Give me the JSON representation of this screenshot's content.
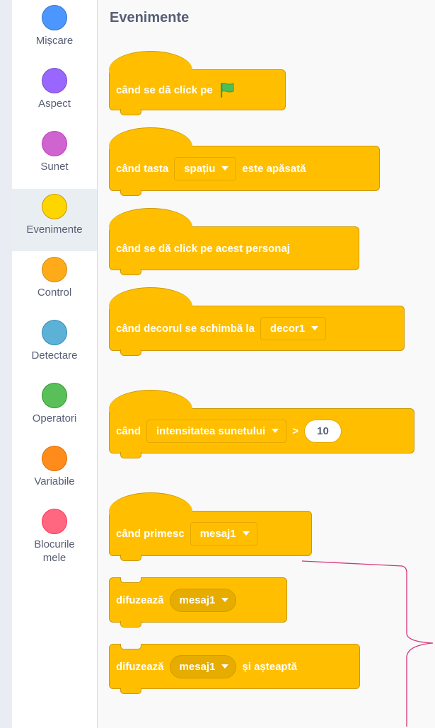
{
  "categories": [
    {
      "id": "motion",
      "label": "Mișcare",
      "color": "#4c97ff",
      "border": "#3373cc",
      "selected": false
    },
    {
      "id": "looks",
      "label": "Aspect",
      "color": "#9966ff",
      "border": "#774dcb",
      "selected": false
    },
    {
      "id": "sound",
      "label": "Sunet",
      "color": "#cf63cf",
      "border": "#bd42bd",
      "selected": false
    },
    {
      "id": "events",
      "label": "Evenimente",
      "color": "#ffd500",
      "border": "#cc9900",
      "selected": true
    },
    {
      "id": "control",
      "label": "Control",
      "color": "#ffab19",
      "border": "#cf8b17",
      "selected": false
    },
    {
      "id": "sensing",
      "label": "Detectare",
      "color": "#5cb1d6",
      "border": "#2e8eb8",
      "selected": false
    },
    {
      "id": "operators",
      "label": "Operatori",
      "color": "#59c059",
      "border": "#389438",
      "selected": false
    },
    {
      "id": "variables",
      "label": "Variabile",
      "color": "#ff8c1a",
      "border": "#db6e00",
      "selected": false
    },
    {
      "id": "myblocks",
      "label": "Blocurile mele",
      "color": "#ff6680",
      "border": "#ff3355",
      "selected": false
    }
  ],
  "palette": {
    "title": "Evenimente",
    "blocks": {
      "flag_clicked": {
        "text": "când se dă click pe",
        "icon": "green-flag-icon"
      },
      "key_pressed": {
        "pre": "când tasta",
        "key": "spațiu",
        "post": "este apăsată"
      },
      "sprite_clicked": {
        "text": "când se dă click pe acest personaj"
      },
      "backdrop_switches": {
        "pre": "când decorul se schimbă la",
        "backdrop": "decor1"
      },
      "greater_than": {
        "pre": "când",
        "sensor": "intensitatea sunetului",
        "op": ">",
        "value": "10"
      },
      "receive": {
        "pre": "când primesc",
        "message": "mesaj1"
      },
      "broadcast": {
        "pre": "difuzează",
        "message": "mesaj1"
      },
      "broadcast_wait": {
        "pre": "difuzează",
        "message": "mesaj1",
        "post": "și așteaptă"
      }
    }
  },
  "colors": {
    "events_block": "#ffbf00",
    "annotation": "#d6337a",
    "flag": "#4cbf56"
  }
}
